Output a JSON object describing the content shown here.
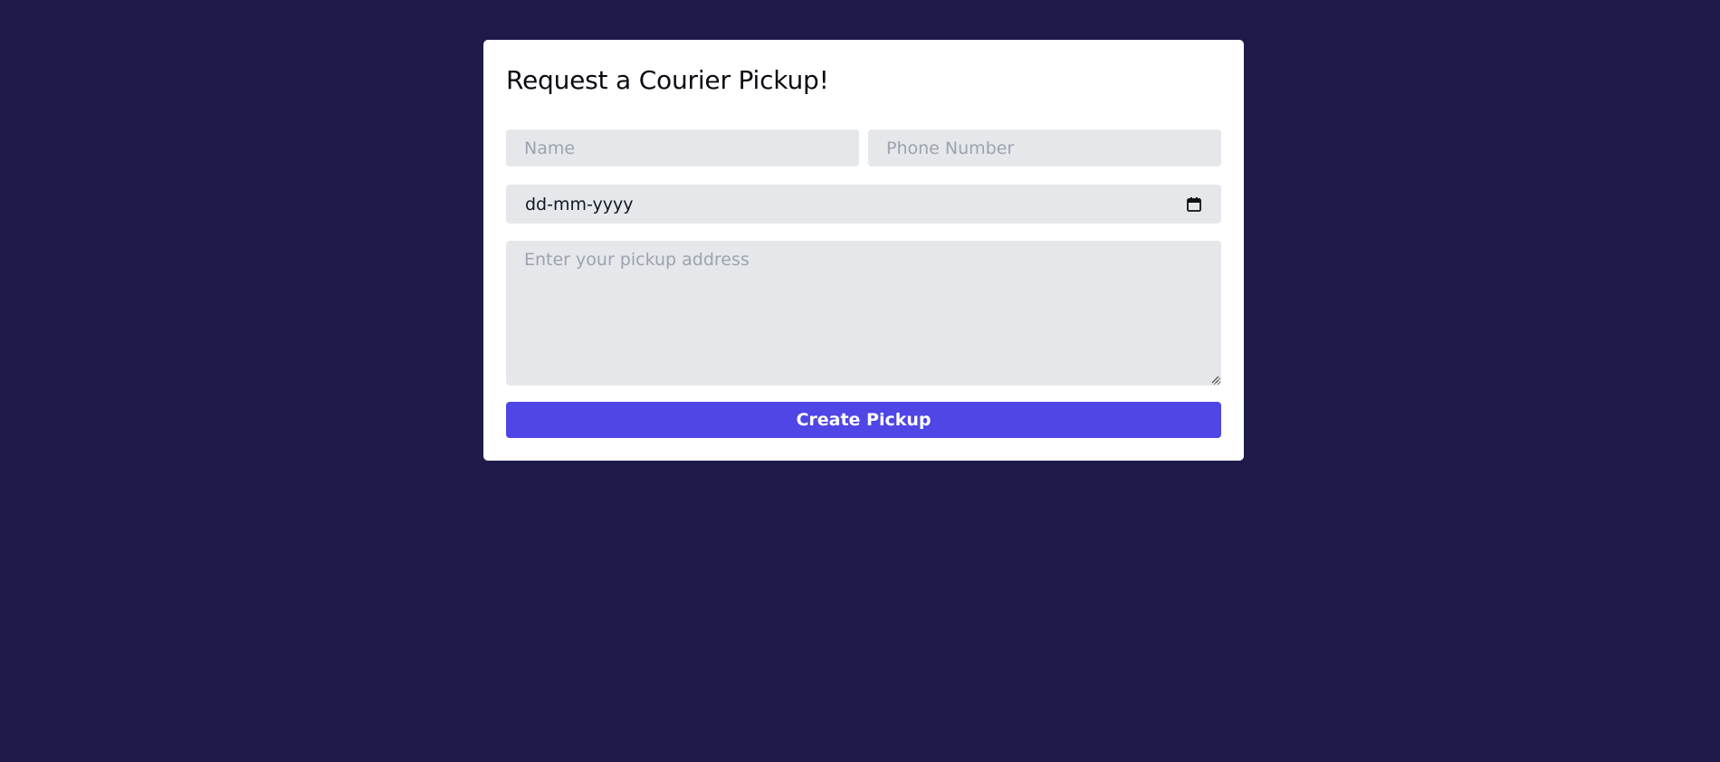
{
  "page": {
    "background_color": "#1e1b4b"
  },
  "form": {
    "title": "Request a Courier Pickup!",
    "name_placeholder": "Name",
    "phone_placeholder": "Phone Number",
    "date_placeholder": "dd-mm-yyyy",
    "date_icon": "calendar-icon",
    "address_placeholder": "Enter your pickup address",
    "submit_label": "Create Pickup",
    "colors": {
      "card": "#ffffff",
      "field": "#e5e7eb",
      "accent": "#4f46e5"
    }
  }
}
